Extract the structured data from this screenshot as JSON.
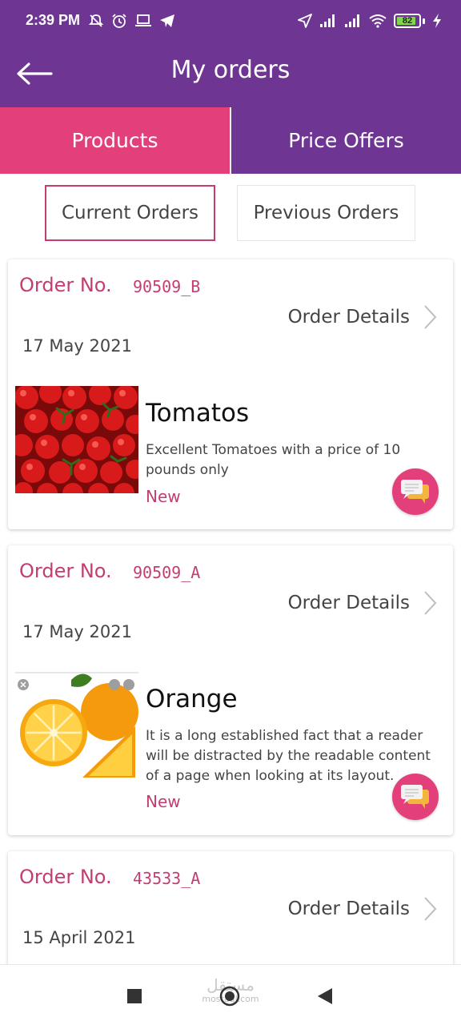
{
  "status_bar": {
    "time": "2:39 PM",
    "battery": "82"
  },
  "app_bar": {
    "title": "My orders"
  },
  "top_tabs": [
    {
      "label": "Products",
      "active": true
    },
    {
      "label": "Price Offers",
      "active": false
    }
  ],
  "sub_tabs": [
    {
      "label": "Current Orders",
      "active": true
    },
    {
      "label": "Previous Orders",
      "active": false
    }
  ],
  "orders": [
    {
      "label": "Order No.",
      "number": "90509_B",
      "details_label": "Order Details",
      "date": "17 May 2021",
      "product": {
        "name": "Tomatos",
        "description": "Excellent Tomatoes with a price of 10 pounds only",
        "status": "New"
      }
    },
    {
      "label": "Order No.",
      "number": "90509_A",
      "details_label": "Order Details",
      "date": "17 May 2021",
      "product": {
        "name": "Orange",
        "description": "It is a long established fact that a reader will be distracted by the readable content of a page when looking at its layout.",
        "status": "New"
      }
    },
    {
      "label": "Order No.",
      "number": "43533_A",
      "details_label": "Order Details",
      "date": "15 April 2021"
    }
  ],
  "watermark": {
    "arabic": "مستقل",
    "latin": "mostaql.com"
  },
  "colors": {
    "purple": "#6e3592",
    "pink": "#e23f7b",
    "accent_text": "#c43d72",
    "battery": "#7fd84a"
  },
  "icons": {
    "status_left": [
      "mute-icon",
      "alarm-icon",
      "laptop-icon",
      "telegram-icon"
    ],
    "status_right": [
      "location-icon",
      "signal-icon",
      "signal-icon",
      "wifi-icon",
      "battery-icon",
      "charging-icon"
    ],
    "card": [
      "chevron-right-icon",
      "chat-icon"
    ],
    "nav": [
      "recents-icon",
      "home-icon",
      "back-icon"
    ]
  }
}
